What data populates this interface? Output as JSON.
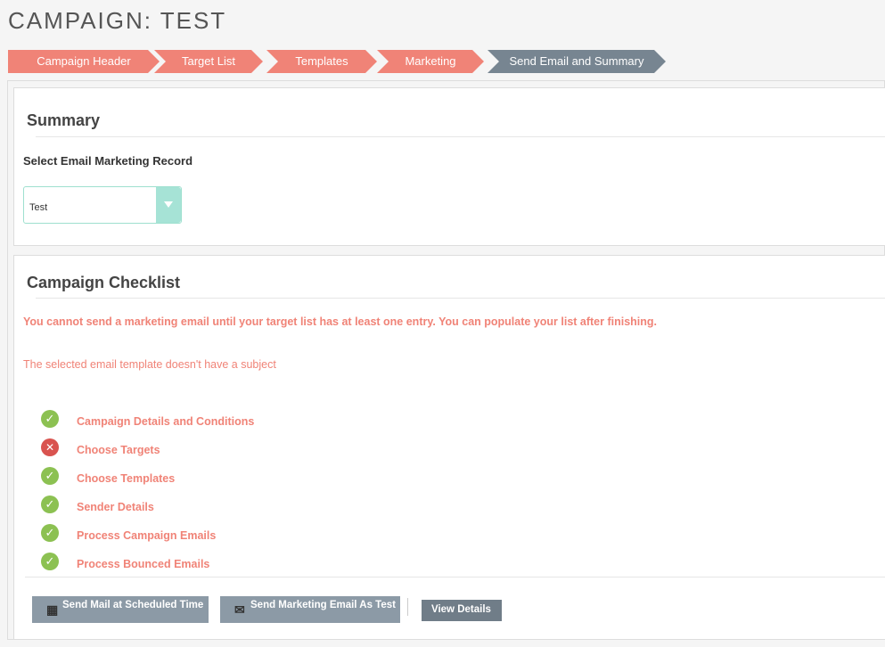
{
  "page": {
    "title": "CAMPAIGN: TEST"
  },
  "wizard": {
    "steps": [
      {
        "label": "Campaign Header",
        "state": "done"
      },
      {
        "label": "Target List",
        "state": "done"
      },
      {
        "label": "Templates",
        "state": "done"
      },
      {
        "label": "Marketing",
        "state": "done"
      },
      {
        "label": "Send Email and Summary",
        "state": "active"
      }
    ]
  },
  "summary": {
    "title": "Summary",
    "select_label": "Select Email Marketing Record",
    "select_value": "Test"
  },
  "checklist": {
    "title": "Campaign Checklist",
    "warning_bold": "You cannot send a marketing email until your target list has at least one entry. You can populate your list after finishing.",
    "warning": "The selected email template doesn't have a subject",
    "items": [
      {
        "label": "Campaign Details and Conditions",
        "status": "ok"
      },
      {
        "label": "Choose Targets",
        "status": "error"
      },
      {
        "label": "Choose Templates",
        "status": "ok"
      },
      {
        "label": "Sender Details",
        "status": "ok"
      },
      {
        "label": "Process Campaign Emails",
        "status": "ok"
      },
      {
        "label": "Process Bounced Emails",
        "status": "ok"
      }
    ]
  },
  "actions": {
    "scheduled_label": "Send Mail at Scheduled Time",
    "test_label": "Send Marketing Email As Test",
    "details_label": "View Details"
  },
  "colors": {
    "accent": "#f08377",
    "active_step": "#778591",
    "ok": "#8cc152",
    "error": "#d9534f"
  }
}
